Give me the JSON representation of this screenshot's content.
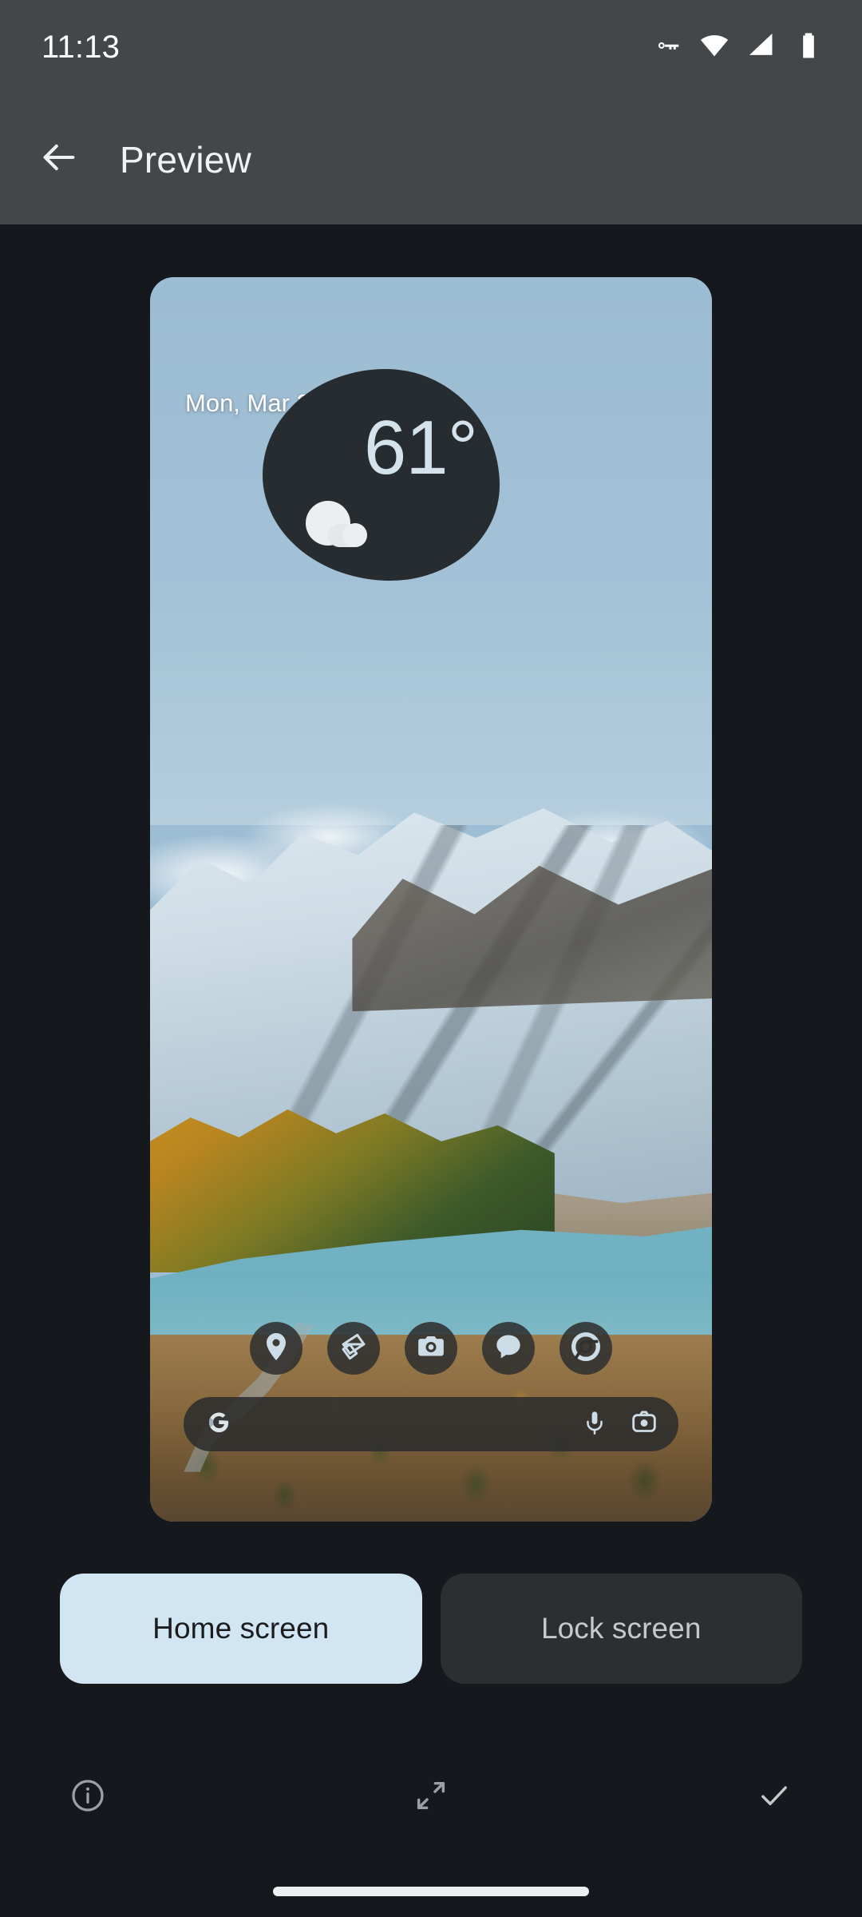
{
  "status_bar": {
    "clock": "11:13",
    "icons": [
      "vpn-key-icon",
      "wifi-icon",
      "signal-icon",
      "battery-icon"
    ],
    "background_color": "#434749"
  },
  "app_bar": {
    "back_label": "back-arrow-icon",
    "title": "Preview",
    "background_color": "#434749"
  },
  "preview": {
    "wallpaper_description": "Snow-covered mountain with autumn larch forest and turquoise alpine lake",
    "date": "Mon, Mar 27",
    "weather": {
      "temperature": "61°",
      "condition_icon": "cloud-icon",
      "blob_color": "#272c30",
      "text_color": "#d4e2ec"
    },
    "dock": [
      {
        "name": "maps",
        "icon": "location-pin-icon"
      },
      {
        "name": "photos",
        "icon": "photos-icon"
      },
      {
        "name": "camera",
        "icon": "camera-icon"
      },
      {
        "name": "messages",
        "icon": "chat-bubble-icon"
      },
      {
        "name": "chrome",
        "icon": "chrome-icon"
      }
    ],
    "search": {
      "leading_icon": "google-g-icon",
      "placeholder": "",
      "value": "",
      "trailing_icons": [
        "microphone-icon",
        "lens-camera-icon"
      ]
    }
  },
  "screen_toggle": {
    "options": [
      {
        "label": "Home screen",
        "selected": true
      },
      {
        "label": "Lock screen",
        "selected": false
      }
    ],
    "selected_color": "#d2e5f2",
    "unselected_color": "#2c2f31"
  },
  "action_bar": {
    "info_label": "info-icon",
    "fullscreen_label": "fullscreen-expand-icon",
    "apply_label": "check-icon"
  },
  "navigation": {
    "gesture_pill": "home-gesture-pill"
  },
  "theme": {
    "page_background": "#15181c",
    "bar_background": "#434749",
    "accent": "#d2e5f2"
  }
}
